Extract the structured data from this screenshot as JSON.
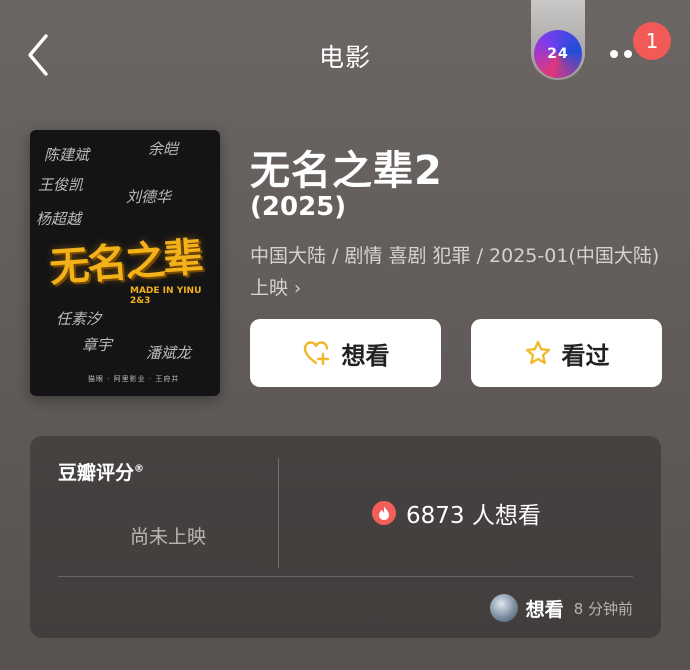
{
  "header": {
    "title": "电影",
    "back_icon": "chevron-left-icon",
    "more_icon": "more-dots-icon",
    "notification_count": "1",
    "avatar_text": "24"
  },
  "poster": {
    "title_art": "无名之辈",
    "badge": "3",
    "subtitle": "MADE IN YINU 2&3",
    "credits": "猫眼 · 阿里影业 · 王府井",
    "signatures": [
      "陈建斌",
      "余皑",
      "王俊凯",
      "任素汐",
      "章宇",
      "潘斌龙",
      "刘德华",
      "杨超越"
    ]
  },
  "movie": {
    "title": "无名之辈2",
    "year": "(2025)",
    "meta": "中国大陆 / 剧情 喜剧 犯罪 / 2025-01(中国大陆)上映",
    "meta_chevron": "›"
  },
  "actions": {
    "want_label": "想看",
    "seen_label": "看过"
  },
  "rating": {
    "label": "豆瓣评分",
    "label_mark": "®",
    "status": "尚未上映",
    "want_count": "6873 人想看",
    "activity_label": "想看",
    "activity_time": "8 分钟前"
  },
  "colors": {
    "background": "#625d5b",
    "badge": "#f25a58",
    "accent_gold": "#f3b21a",
    "fire": "#f45e5a"
  }
}
